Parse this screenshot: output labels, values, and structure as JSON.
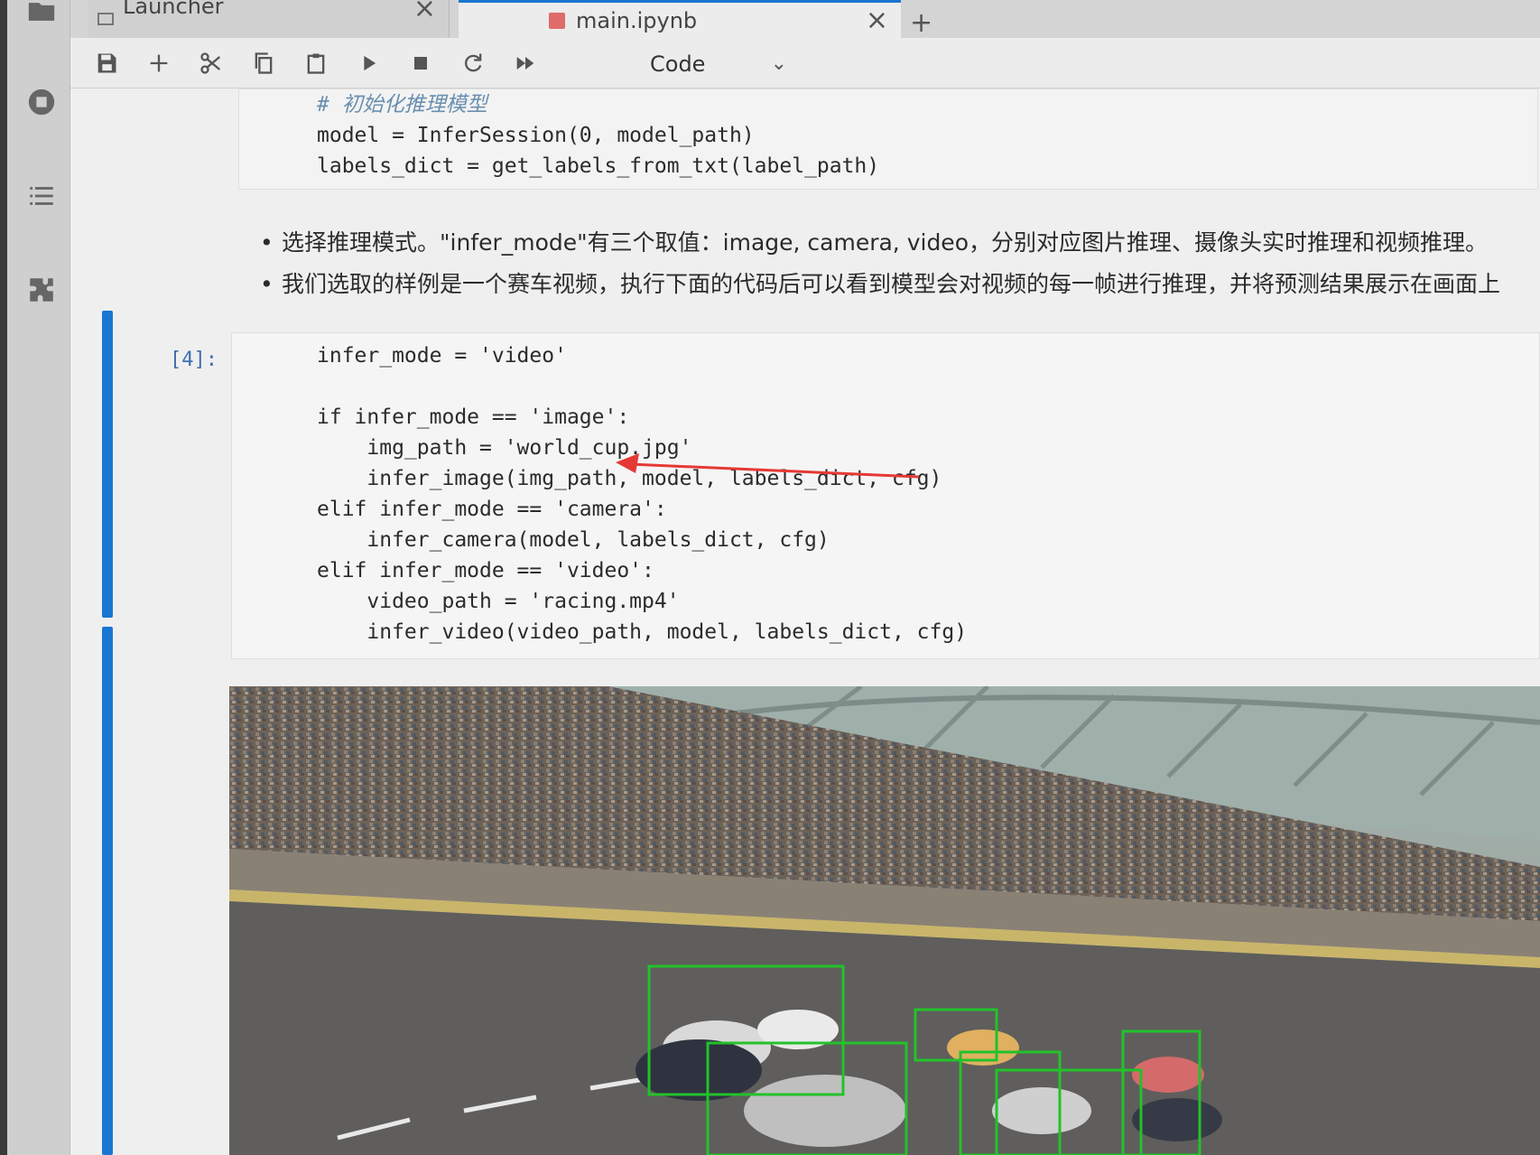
{
  "tabs": {
    "launcher_label": "Launcher",
    "notebook_label": "main.ipynb",
    "close_symbol": "×",
    "new_tab_symbol": "+"
  },
  "toolbar": {
    "buttons": [
      "save-icon",
      "plus-icon",
      "cut-icon",
      "copy-icon",
      "paste-icon",
      "run-icon",
      "stop-icon",
      "restart-icon",
      "fast-forward-icon"
    ],
    "cell_type": "Code"
  },
  "prev_cell": {
    "comment": "# 初始化推理模型",
    "line2": "model = InferSession(0, model_path)",
    "line3": "labels_dict = get_labels_from_txt(label_path)"
  },
  "markdown": {
    "bullet1": "选择推理模式。\"infer_mode\"有三个取值：image, camera, video，分别对应图片推理、摄像头实时推理和视频推理。",
    "bullet2": "我们选取的样例是一个赛车视频，执行下面的代码后可以看到模型会对视频的每一帧进行推理，并将预测结果展示在画面上"
  },
  "active_cell": {
    "prompt": "[4]:",
    "lines": [
      "infer_mode = 'video'",
      "",
      "if infer_mode == 'image':",
      "    img_path = 'world_cup.jpg'",
      "    infer_image(img_path, model, labels_dict, cfg)",
      "elif infer_mode == 'camera':",
      "    infer_camera(model, labels_dict, cfg)",
      "elif infer_mode == 'video':",
      "    video_path = 'racing.mp4'",
      "    infer_video(video_path, model, labels_dict, cfg)"
    ]
  },
  "colors": {
    "accent": "#1976d2",
    "detection_box": "#22c22a",
    "annotation_arrow": "#e53935"
  },
  "output": {
    "description_icon": "video-frame-output",
    "detections_shown": 6
  }
}
